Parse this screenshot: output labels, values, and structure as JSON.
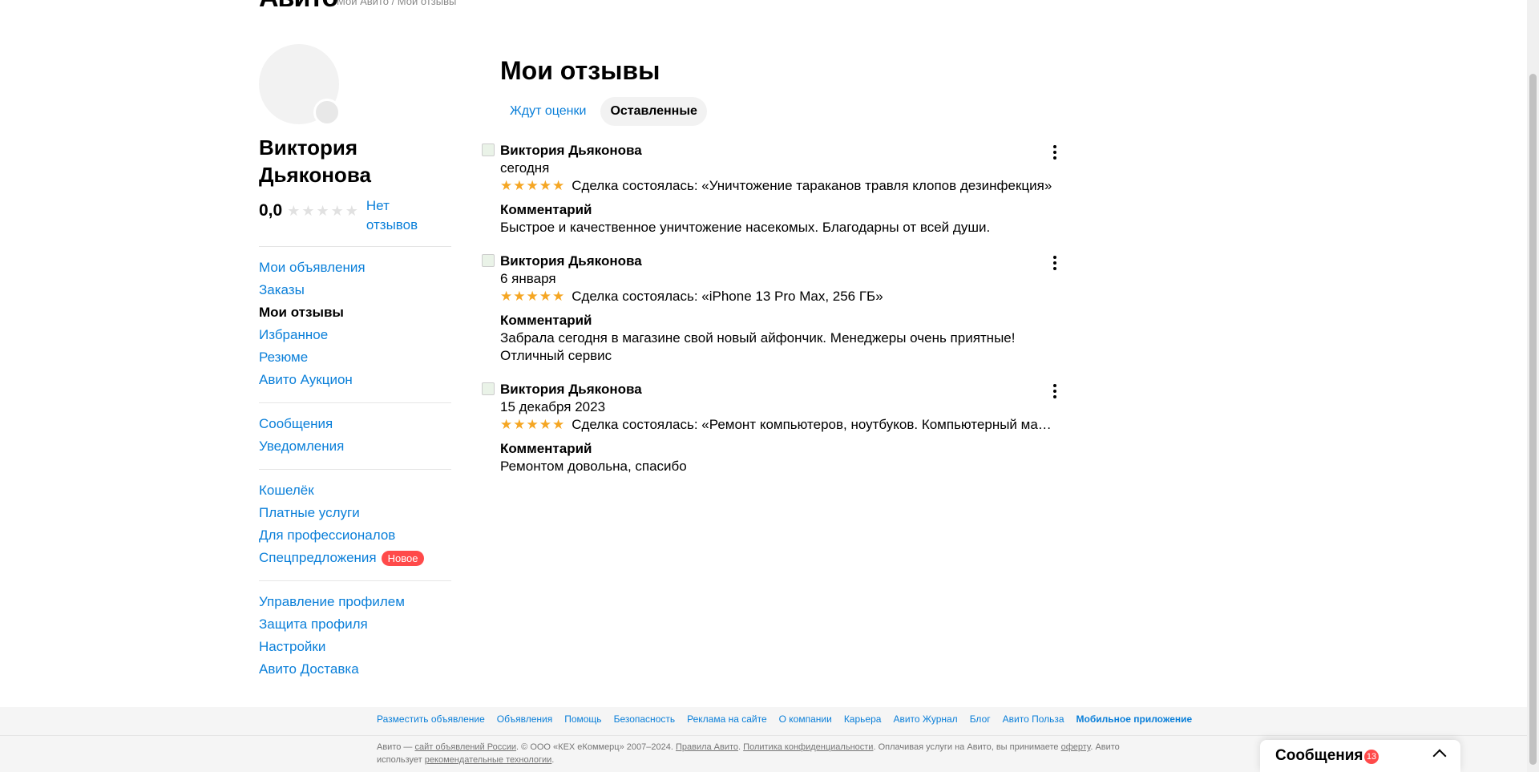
{
  "header": {
    "logo": "Авито",
    "breadcrumb": "Мой Авито / Мои отзывы"
  },
  "sidebar": {
    "user_name": "Виктория Дьяконова",
    "rating": "0,0",
    "no_reviews": "Нет отзывов",
    "groups": [
      [
        {
          "label": "Мои объявления"
        },
        {
          "label": "Заказы"
        },
        {
          "label": "Мои отзывы",
          "active": true
        },
        {
          "label": "Избранное"
        },
        {
          "label": "Резюме"
        },
        {
          "label": "Авито Аукцион"
        }
      ],
      [
        {
          "label": "Сообщения"
        },
        {
          "label": "Уведомления"
        }
      ],
      [
        {
          "label": "Кошелёк"
        },
        {
          "label": "Платные услуги"
        },
        {
          "label": "Для профессионалов"
        },
        {
          "label": "Спецпредложения",
          "badge": "Новое"
        }
      ],
      [
        {
          "label": "Управление профилем"
        },
        {
          "label": "Защита профиля"
        },
        {
          "label": "Настройки"
        },
        {
          "label": "Авито Доставка"
        }
      ]
    ]
  },
  "main": {
    "title": "Мои отзывы",
    "tabs": [
      {
        "label": "Ждут оценки",
        "active": false
      },
      {
        "label": "Оставленные",
        "active": true
      }
    ],
    "reviews": [
      {
        "author": "Виктория Дьяконова",
        "date": "сегодня",
        "stars": 5,
        "deal": "Сделка состоялась: «Уничтожение тараканов травля клопов дезинфекция»",
        "comment_title": "Комментарий",
        "comment": "Быстрое и качественное уничтожение насекомых. Благодарны от всей души."
      },
      {
        "author": "Виктория Дьяконова",
        "date": "6 января",
        "stars": 5,
        "deal": "Сделка состоялась: «iPhone 13 Pro Max, 256 ГБ»",
        "comment_title": "Комментарий",
        "comment": "Забрала сегодня в магазине свой новый айфончик. Менеджеры очень приятные! Отличный сервис"
      },
      {
        "author": "Виктория Дьяконова",
        "date": "15 декабря 2023",
        "stars": 5,
        "deal": "Сделка состоялась: «Ремонт компьютеров, ноутбуков. Компьютерный мастер»",
        "comment_title": "Комментарий",
        "comment": "Ремонтом довольна, спасибо"
      }
    ]
  },
  "footer": {
    "links": [
      {
        "label": "Разместить объявление"
      },
      {
        "label": "Объявления"
      },
      {
        "label": "Помощь"
      },
      {
        "label": "Безопасность"
      },
      {
        "label": "Реклама на сайте"
      },
      {
        "label": "О компании"
      },
      {
        "label": "Карьера"
      },
      {
        "label": "Авито Журнал"
      },
      {
        "label": "Блог"
      },
      {
        "label": "Авито Польза"
      },
      {
        "label": "Мобильное приложение",
        "bold": true
      }
    ],
    "copy_1": "Авито — ",
    "copy_link_1": "сайт объявлений России",
    "copy_2": ". © ООО «КЕХ еКоммерц» 2007–2024. ",
    "copy_link_2": "Правила Авито",
    "copy_3": ". ",
    "copy_link_3": "Политика конфиденциальности",
    "copy_4": ". Оплачивая услуги на Авито, вы принимаете ",
    "copy_link_4": "оферту",
    "copy_5": ". Авито использует ",
    "copy_link_5": "рекомендательные технологии",
    "copy_6": "."
  },
  "messages_widget": {
    "label": "Сообщения",
    "count": "13"
  },
  "colors": {
    "link": "#0a7fd9",
    "star": "#f5a623",
    "badge": "#ff4a4a"
  }
}
